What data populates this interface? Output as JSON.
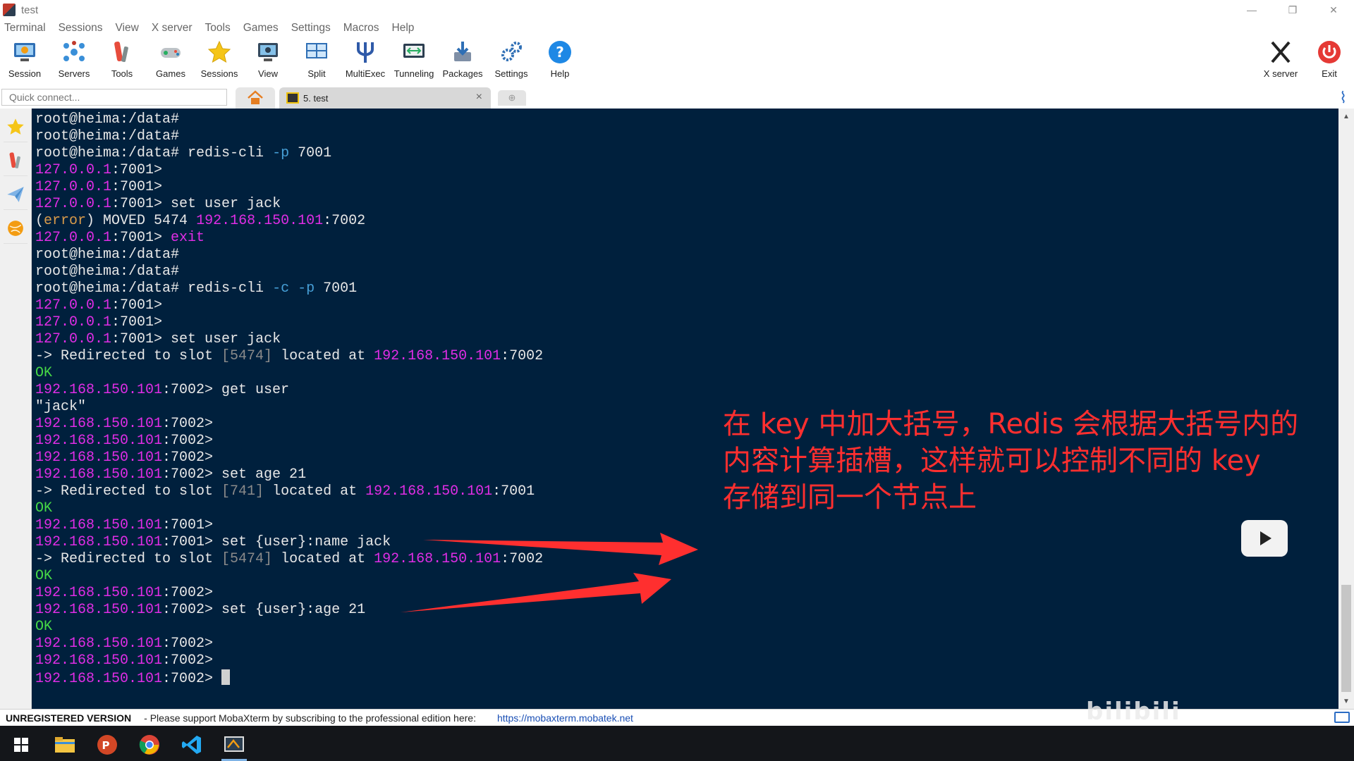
{
  "window": {
    "title": "test",
    "controls": [
      "—",
      "❐",
      "✕"
    ]
  },
  "menu": [
    "Terminal",
    "Sessions",
    "View",
    "X server",
    "Tools",
    "Games",
    "Settings",
    "Macros",
    "Help"
  ],
  "toolbar": {
    "session": "Session",
    "servers": "Servers",
    "tools": "Tools",
    "games": "Games",
    "sessions": "Sessions",
    "view": "View",
    "split": "Split",
    "multiexec": "MultiExec",
    "tunneling": "Tunneling",
    "packages": "Packages",
    "settings": "Settings",
    "help": "Help",
    "xserver": "X server",
    "exit": "Exit"
  },
  "tabs": {
    "quick_connect_placeholder": "Quick connect...",
    "session_tab_label": "5. test",
    "close": "×"
  },
  "terminal": {
    "lines": [
      [
        {
          "t": "root@heima:/data#",
          "c": "w"
        }
      ],
      [
        {
          "t": "root@heima:/data#",
          "c": "w"
        }
      ],
      [
        {
          "t": "root@heima:/data# redis-cli ",
          "c": "w"
        },
        {
          "t": "-p",
          "c": "b"
        },
        {
          "t": " 7001",
          "c": "w"
        }
      ],
      [
        {
          "t": "127.0.0.1",
          "c": "m"
        },
        {
          "t": ":7001>",
          "c": "w"
        }
      ],
      [
        {
          "t": "127.0.0.1",
          "c": "m"
        },
        {
          "t": ":7001>",
          "c": "w"
        }
      ],
      [
        {
          "t": "127.0.0.1",
          "c": "m"
        },
        {
          "t": ":7001> set user jack",
          "c": "w"
        }
      ],
      [
        {
          "t": "(",
          "c": "w"
        },
        {
          "t": "error",
          "c": "o"
        },
        {
          "t": ") MOVED 5474 ",
          "c": "w"
        },
        {
          "t": "192.168.150.101",
          "c": "m"
        },
        {
          "t": ":7002",
          "c": "w"
        }
      ],
      [
        {
          "t": "127.0.0.1",
          "c": "m"
        },
        {
          "t": ":7001> ",
          "c": "w"
        },
        {
          "t": "exit",
          "c": "m"
        }
      ],
      [
        {
          "t": "root@heima:/data#",
          "c": "w"
        }
      ],
      [
        {
          "t": "root@heima:/data#",
          "c": "w"
        }
      ],
      [
        {
          "t": "root@heima:/data# redis-cli ",
          "c": "w"
        },
        {
          "t": "-c -p",
          "c": "b"
        },
        {
          "t": " 7001",
          "c": "w"
        }
      ],
      [
        {
          "t": "127.0.0.1",
          "c": "m"
        },
        {
          "t": ":7001>",
          "c": "w"
        }
      ],
      [
        {
          "t": "127.0.0.1",
          "c": "m"
        },
        {
          "t": ":7001>",
          "c": "w"
        }
      ],
      [
        {
          "t": "127.0.0.1",
          "c": "m"
        },
        {
          "t": ":7001> set user jack",
          "c": "w"
        }
      ],
      [
        {
          "t": "-> Redirected to slot ",
          "c": "w"
        },
        {
          "t": "[5474]",
          "c": "gr"
        },
        {
          "t": " located at ",
          "c": "w"
        },
        {
          "t": "192.168.150.101",
          "c": "m"
        },
        {
          "t": ":7002",
          "c": "w"
        }
      ],
      [
        {
          "t": "OK",
          "c": "g"
        }
      ],
      [
        {
          "t": "192.168.150.101",
          "c": "m"
        },
        {
          "t": ":7002> get user",
          "c": "w"
        }
      ],
      [
        {
          "t": "\"jack\"",
          "c": "w"
        }
      ],
      [
        {
          "t": "192.168.150.101",
          "c": "m"
        },
        {
          "t": ":7002>",
          "c": "w"
        }
      ],
      [
        {
          "t": "192.168.150.101",
          "c": "m"
        },
        {
          "t": ":7002>",
          "c": "w"
        }
      ],
      [
        {
          "t": "192.168.150.101",
          "c": "m"
        },
        {
          "t": ":7002>",
          "c": "w"
        }
      ],
      [
        {
          "t": "192.168.150.101",
          "c": "m"
        },
        {
          "t": ":7002> set age 21",
          "c": "w"
        }
      ],
      [
        {
          "t": "-> Redirected to slot ",
          "c": "w"
        },
        {
          "t": "[741]",
          "c": "gr"
        },
        {
          "t": " located at ",
          "c": "w"
        },
        {
          "t": "192.168.150.101",
          "c": "m"
        },
        {
          "t": ":7001",
          "c": "w"
        }
      ],
      [
        {
          "t": "OK",
          "c": "g"
        }
      ],
      [
        {
          "t": "192.168.150.101",
          "c": "m"
        },
        {
          "t": ":7001>",
          "c": "w"
        }
      ],
      [
        {
          "t": "192.168.150.101",
          "c": "m"
        },
        {
          "t": ":7001> set {user}:name jack",
          "c": "w"
        }
      ],
      [
        {
          "t": "-> Redirected to slot ",
          "c": "w"
        },
        {
          "t": "[5474]",
          "c": "gr"
        },
        {
          "t": " located at ",
          "c": "w"
        },
        {
          "t": "192.168.150.101",
          "c": "m"
        },
        {
          "t": ":7002",
          "c": "w"
        }
      ],
      [
        {
          "t": "OK",
          "c": "g"
        }
      ],
      [
        {
          "t": "192.168.150.101",
          "c": "m"
        },
        {
          "t": ":7002>",
          "c": "w"
        }
      ],
      [
        {
          "t": "192.168.150.101",
          "c": "m"
        },
        {
          "t": ":7002> set {user}:age 21",
          "c": "w"
        }
      ],
      [
        {
          "t": "OK",
          "c": "g"
        }
      ],
      [
        {
          "t": "192.168.150.101",
          "c": "m"
        },
        {
          "t": ":7002>",
          "c": "w"
        }
      ],
      [
        {
          "t": "192.168.150.101",
          "c": "m"
        },
        {
          "t": ":7002>",
          "c": "w"
        }
      ],
      [
        {
          "t": "192.168.150.101",
          "c": "m"
        },
        {
          "t": ":7002> ",
          "c": "w"
        }
      ]
    ]
  },
  "annotation": {
    "lines": [
      "在 key 中加大括号，Redis 会根据大括号内的",
      "内容计算插槽，这样就可以控制不同的 key",
      "存储到同一个节点上"
    ]
  },
  "statusbar": {
    "unregistered": "UNREGISTERED VERSION",
    "message": "-  Please support MobaXterm by subscribing to the professional edition here:",
    "link": "https://mobaxterm.mobatek.net"
  },
  "colors": {
    "terminal_bg": "#00203d",
    "magenta": "#e02de6",
    "blue": "#46a0d8",
    "green": "#46d846",
    "annotation_red": "#ff2f2f"
  }
}
